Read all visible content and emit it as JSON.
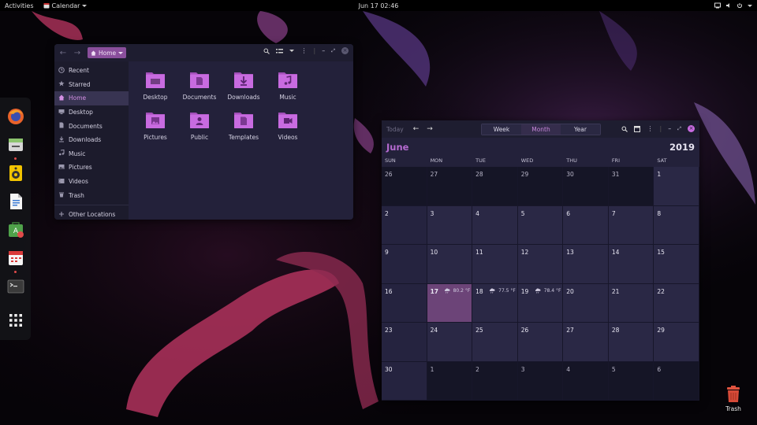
{
  "topbar": {
    "activities": "Activities",
    "app_menu": "Calendar",
    "clock": "Jun 17  02:46"
  },
  "dock": {
    "items": [
      {
        "icon": "firefox-icon",
        "running": false
      },
      {
        "icon": "files-icon",
        "running": true
      },
      {
        "icon": "rhythmbox-icon",
        "running": false
      },
      {
        "icon": "writer-icon",
        "running": false
      },
      {
        "icon": "software-icon",
        "running": false
      },
      {
        "icon": "calendar-icon",
        "running": true
      },
      {
        "icon": "terminal-icon",
        "running": false
      },
      {
        "icon": "show-apps-icon",
        "running": false
      }
    ]
  },
  "files": {
    "path_label": "Home",
    "sidebar": [
      {
        "label": "Recent",
        "icon": "clock-icon"
      },
      {
        "label": "Starred",
        "icon": "star-icon"
      },
      {
        "label": "Home",
        "icon": "home-icon",
        "active": true
      },
      {
        "label": "Desktop",
        "icon": "desktop-icon"
      },
      {
        "label": "Documents",
        "icon": "documents-icon"
      },
      {
        "label": "Downloads",
        "icon": "downloads-icon"
      },
      {
        "label": "Music",
        "icon": "music-icon"
      },
      {
        "label": "Pictures",
        "icon": "pictures-icon"
      },
      {
        "label": "Videos",
        "icon": "videos-icon"
      },
      {
        "label": "Trash",
        "icon": "trash-icon"
      },
      {
        "label": "Other Locations",
        "icon": "plus-icon"
      }
    ],
    "folders": [
      {
        "label": "Desktop",
        "emblem": "desktop"
      },
      {
        "label": "Documents",
        "emblem": "document"
      },
      {
        "label": "Downloads",
        "emblem": "download"
      },
      {
        "label": "Music",
        "emblem": "music"
      },
      {
        "label": "Pictures",
        "emblem": "picture"
      },
      {
        "label": "Public",
        "emblem": "person"
      },
      {
        "label": "Templates",
        "emblem": "template"
      },
      {
        "label": "Videos",
        "emblem": "video"
      }
    ]
  },
  "calendar": {
    "today_label": "Today",
    "views": [
      "Week",
      "Month",
      "Year"
    ],
    "selected_view": "Month",
    "month": "June",
    "year": "2019",
    "weekdays": [
      "SUN",
      "MON",
      "TUE",
      "WED",
      "THU",
      "FRI",
      "SAT"
    ],
    "weeks": [
      [
        {
          "d": "26",
          "o": true
        },
        {
          "d": "27",
          "o": true
        },
        {
          "d": "28",
          "o": true
        },
        {
          "d": "29",
          "o": true
        },
        {
          "d": "30",
          "o": true
        },
        {
          "d": "31",
          "o": true
        },
        {
          "d": "1"
        }
      ],
      [
        {
          "d": "2"
        },
        {
          "d": "3"
        },
        {
          "d": "4"
        },
        {
          "d": "5"
        },
        {
          "d": "6"
        },
        {
          "d": "7"
        },
        {
          "d": "8"
        }
      ],
      [
        {
          "d": "9"
        },
        {
          "d": "10"
        },
        {
          "d": "11"
        },
        {
          "d": "12"
        },
        {
          "d": "13"
        },
        {
          "d": "14"
        },
        {
          "d": "15"
        }
      ],
      [
        {
          "d": "16"
        },
        {
          "d": "17",
          "today": true,
          "w": "80.2 °F"
        },
        {
          "d": "18",
          "w": "77.5 °F"
        },
        {
          "d": "19",
          "w": "78.4 °F"
        },
        {
          "d": "20"
        },
        {
          "d": "21"
        },
        {
          "d": "22"
        }
      ],
      [
        {
          "d": "23"
        },
        {
          "d": "24"
        },
        {
          "d": "25"
        },
        {
          "d": "26"
        },
        {
          "d": "27"
        },
        {
          "d": "28"
        },
        {
          "d": "29"
        }
      ],
      [
        {
          "d": "30"
        },
        {
          "d": "1",
          "o": true
        },
        {
          "d": "2",
          "o": true
        },
        {
          "d": "3",
          "o": true
        },
        {
          "d": "4",
          "o": true
        },
        {
          "d": "5",
          "o": true
        },
        {
          "d": "6",
          "o": true
        }
      ]
    ]
  },
  "desktop": {
    "trash_label": "Trash"
  },
  "colors": {
    "accent": "#b56ad0",
    "folder": "#c86be0",
    "window_bg": "#23213a"
  }
}
